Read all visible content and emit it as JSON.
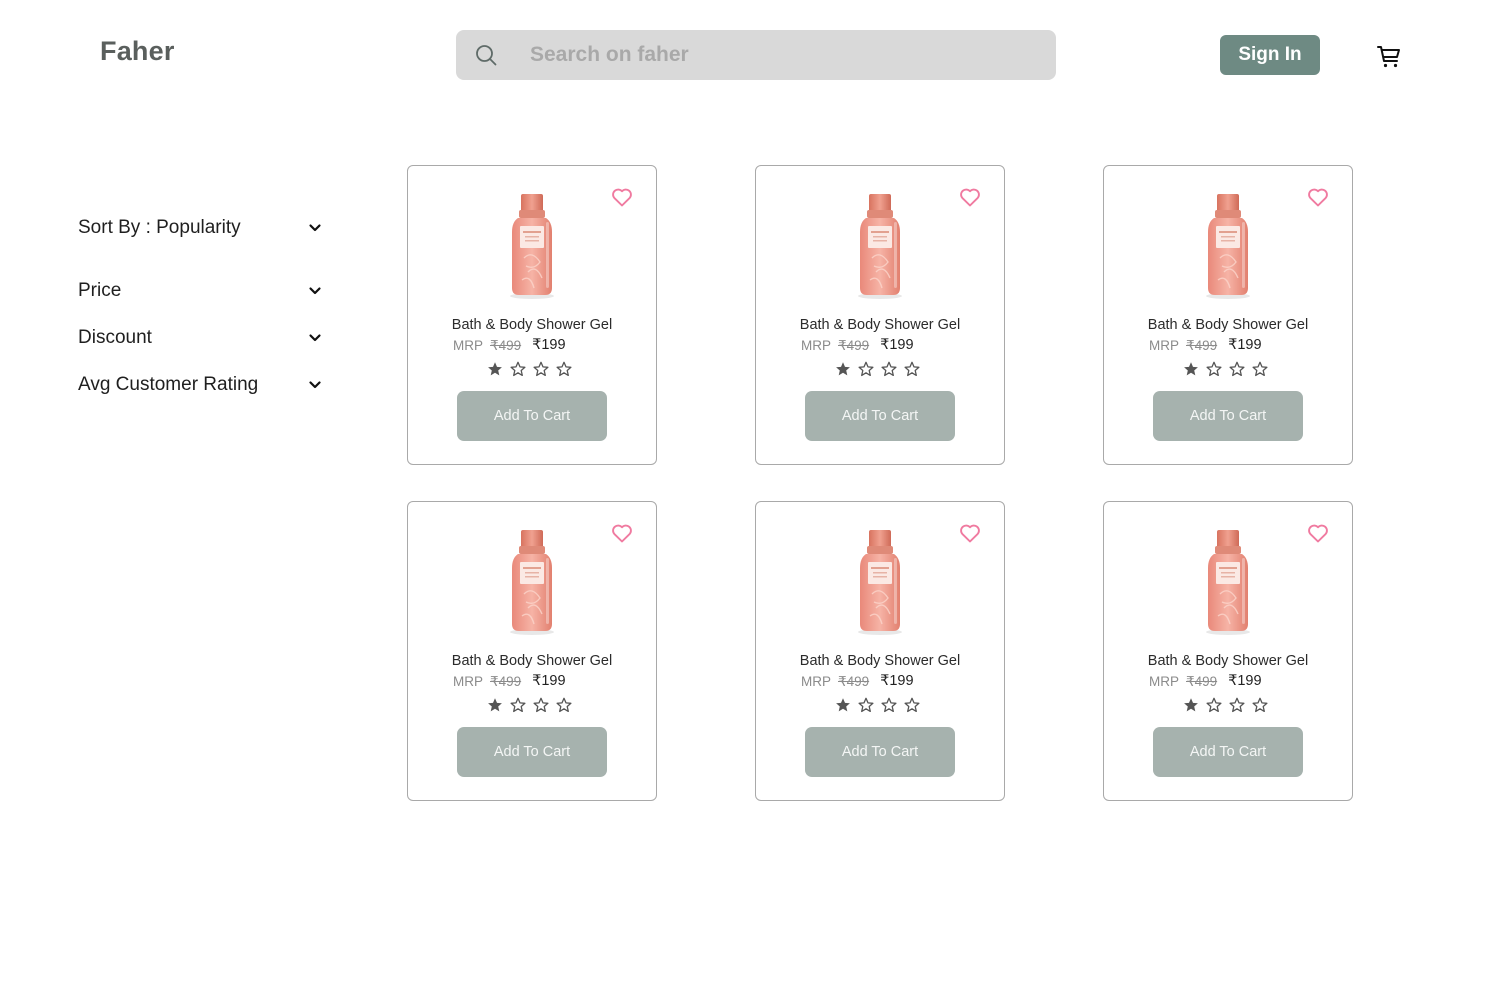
{
  "header": {
    "logo": "Faher",
    "search_placeholder": "Search on faher",
    "sign_in_label": "Sign In",
    "icons": {
      "search": "search-icon",
      "cart": "cart-icon"
    }
  },
  "filters": [
    {
      "label": "Sort By : Popularity",
      "icon": "chevron-down-icon"
    },
    {
      "label": "Price",
      "icon": "chevron-down-icon"
    },
    {
      "label": "Discount",
      "icon": "chevron-down-icon"
    },
    {
      "label": "Avg Customer Rating",
      "icon": "chevron-down-icon"
    }
  ],
  "products": [
    {
      "name": "Bath & Body Shower Gel",
      "mrp_label": "MRP",
      "mrp": "₹499",
      "price": "₹199",
      "rating": 1,
      "rating_max": 4,
      "button": "Add To Cart"
    },
    {
      "name": "Bath & Body Shower Gel",
      "mrp_label": "MRP",
      "mrp": "₹499",
      "price": "₹199",
      "rating": 1,
      "rating_max": 4,
      "button": "Add To Cart"
    },
    {
      "name": "Bath & Body Shower Gel",
      "mrp_label": "MRP",
      "mrp": "₹499",
      "price": "₹199",
      "rating": 1,
      "rating_max": 4,
      "button": "Add To Cart"
    },
    {
      "name": "Bath & Body Shower Gel",
      "mrp_label": "MRP",
      "mrp": "₹499",
      "price": "₹199",
      "rating": 1,
      "rating_max": 4,
      "button": "Add To Cart"
    },
    {
      "name": "Bath & Body Shower Gel",
      "mrp_label": "MRP",
      "mrp": "₹499",
      "price": "₹199",
      "rating": 1,
      "rating_max": 4,
      "button": "Add To Cart"
    },
    {
      "name": "Bath & Body Shower Gel",
      "mrp_label": "MRP",
      "mrp": "₹499",
      "price": "₹199",
      "rating": 1,
      "rating_max": 4,
      "button": "Add To Cart"
    }
  ],
  "colors": {
    "accent": "#6e8a83",
    "add_to_cart_bg": "#a6b2ae",
    "heart": "#f07aa0",
    "search_bg": "#d9d9d9",
    "logo": "#5a5f5d"
  }
}
